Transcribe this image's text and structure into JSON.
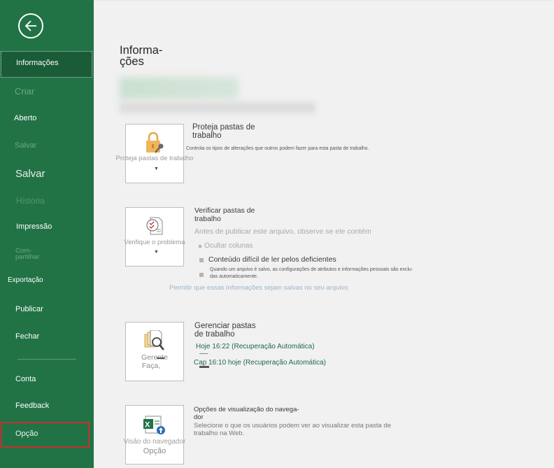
{
  "sidebar": {
    "back_icon": "back-arrow-icon",
    "items": [
      {
        "label": "Informações"
      },
      {
        "label": "Criar"
      },
      {
        "label": "Aberto"
      },
      {
        "label": "Salvar"
      },
      {
        "label": "Salvar"
      },
      {
        "label": "História"
      },
      {
        "label": "Impressão"
      },
      {
        "label": "Com-"
      },
      {
        "label": "partilhar"
      },
      {
        "label": "Exportação"
      },
      {
        "label": "Publicar"
      },
      {
        "label": "Fechar"
      },
      {
        "label": "Conta"
      },
      {
        "label": "Feedback"
      },
      {
        "label": "Opção"
      }
    ]
  },
  "main": {
    "title_line1": "Informa-",
    "title_line2": "ções",
    "protect": {
      "tile_label": "Proteja pastas de trabalho",
      "title_line1": "Proteja pastas de",
      "title_line2": "trabalho",
      "desc": "Controla os tipos de alterações que outros podem fazer para esta pasta de trabalho."
    },
    "inspect": {
      "tile_label": "Verifique o problema",
      "title_line1": "Verificar pastas de",
      "title_line2": "trabalho",
      "intro": "Antes de publicar este arquivo, observe se ele contém",
      "items": [
        "Ocultar colunas",
        "Conteúdo difícil de ler pelos deficientes",
        "Quando um arquivo é salvo, as configurações de atributos e informações pessoais são exclu-",
        "das automaticamente."
      ],
      "link": "Permitir que essas informações sejam salvas no seu arquivo"
    },
    "manage": {
      "tile_label_1": "Gerente",
      "tile_label_2": "Faça,",
      "title_line1": "Gerenciar pastas",
      "title_line2": "de trabalho",
      "versions": [
        "Hoje 16:22 (Recuperação Automática)",
        "Cap 16:10 hoje (Recuperação Automática)"
      ]
    },
    "browser": {
      "tile_label_1": "Visão do navegador",
      "tile_label_2": "Opção",
      "title_line1": "Opções de visualização do navega-",
      "title_line2": "dor",
      "desc_line1": "Selecione o que os usuários podem ver ao visualizar esta pasta de",
      "desc_line2": "trabalho na Web."
    }
  }
}
